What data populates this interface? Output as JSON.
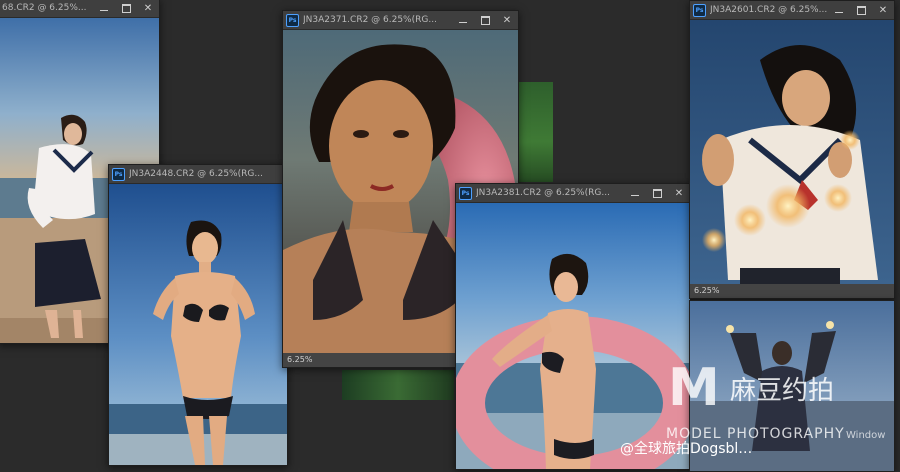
{
  "windows": [
    {
      "id": "w1",
      "title": "68.CR2 @ 6.25%...",
      "controls": [
        "–",
        "□",
        "✕"
      ]
    },
    {
      "id": "w2",
      "title": "JN3A2448.CR2 @ 6.25%(RG...",
      "controls": [
        "–",
        "□",
        "✕"
      ]
    },
    {
      "id": "w3",
      "title": "JN3A2371.CR2 @ 6.25%(RG...",
      "controls": [
        "–",
        "□",
        "✕"
      ],
      "status": "6.25%"
    },
    {
      "id": "w4",
      "title": "JN3A2381.CR2 @ 6.25%(RG...",
      "controls": [
        "–",
        "□",
        "✕"
      ]
    },
    {
      "id": "w5",
      "title": "JN3A2601.CR2 @ 6.25%...",
      "controls": [
        "–",
        "□",
        "✕"
      ],
      "status": "6.25%"
    }
  ],
  "watermark": {
    "logo_letter": "M",
    "cn": "麻豆约拍",
    "en": "MODEL PHOTOGRAPHY",
    "bottom_text": "@全球旅拍Dogsbl…",
    "corner": "Window"
  },
  "colors": {
    "app_bg": "#2b2b2b",
    "panel": "#3c3c3c",
    "ps_blue": "#4da0ff"
  }
}
